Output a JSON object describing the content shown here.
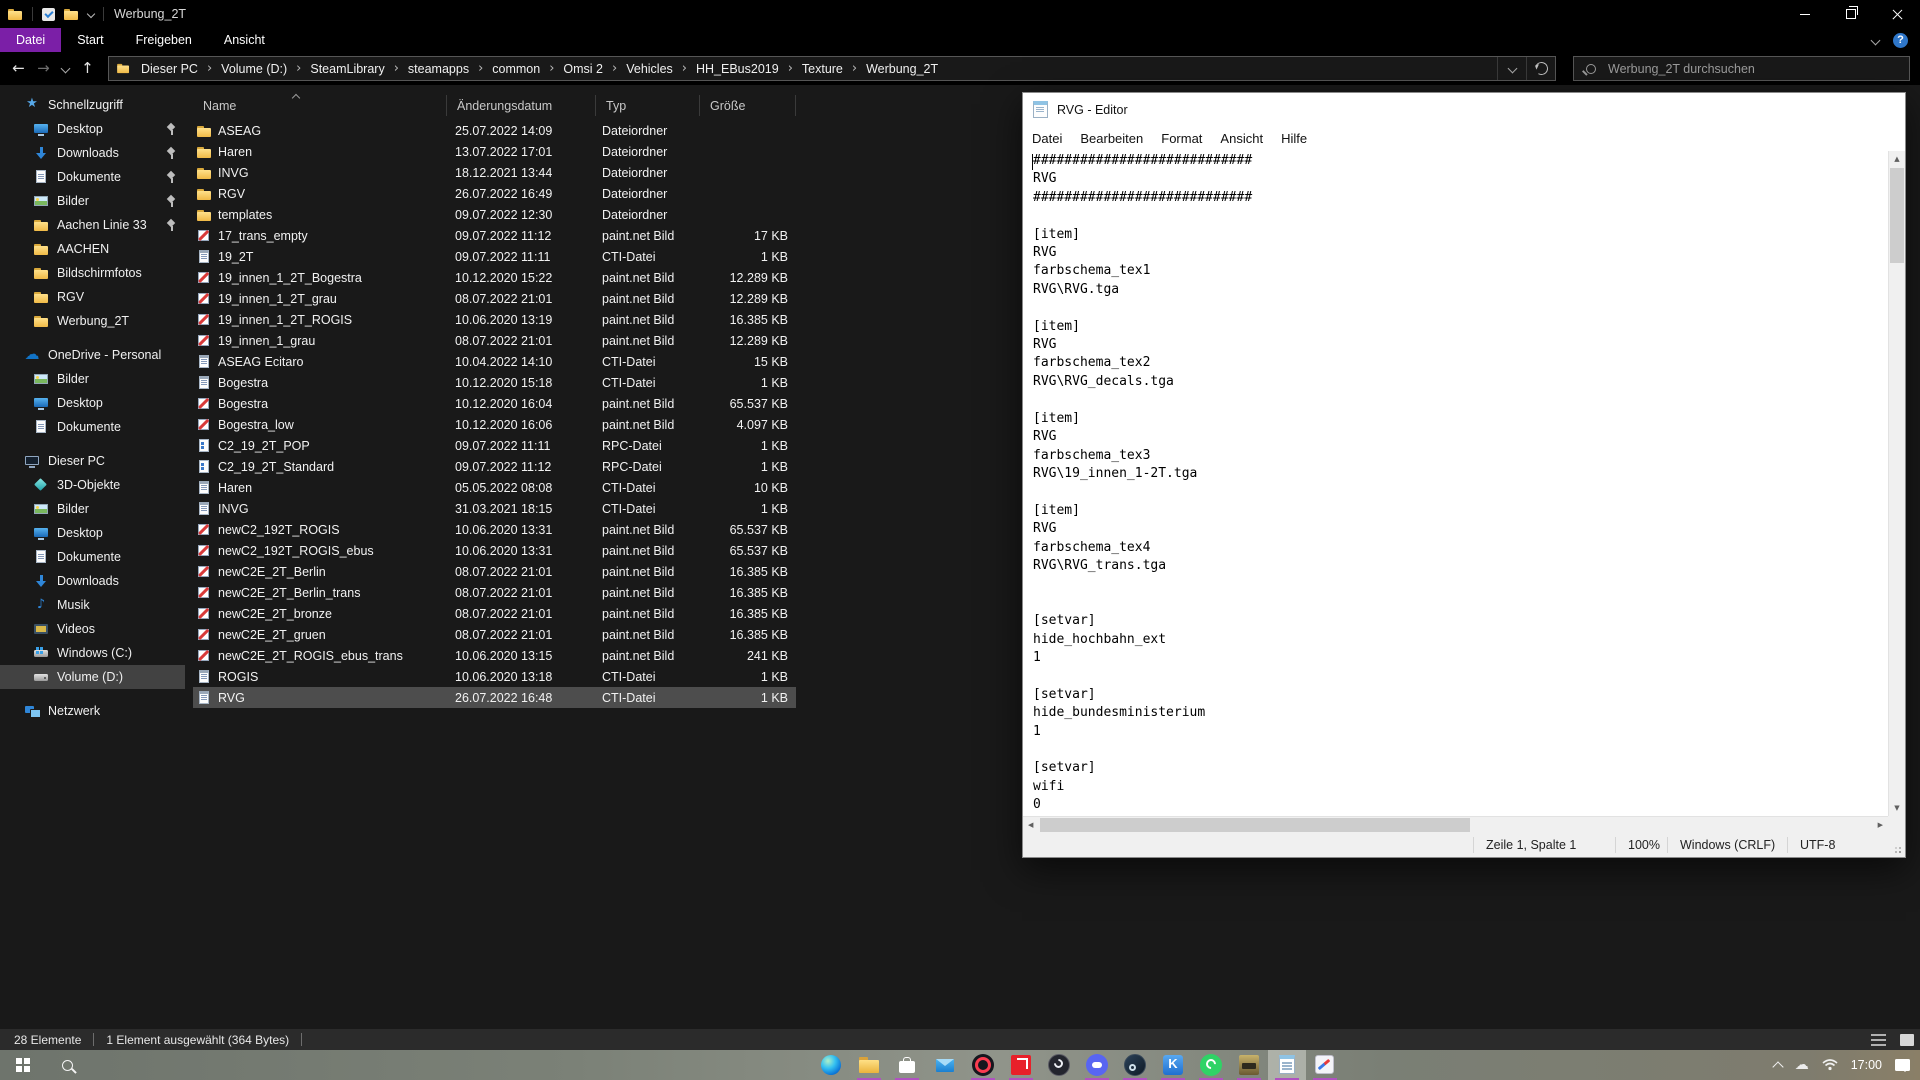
{
  "explorer": {
    "window_title": "Werbung_2T",
    "ribbon_tabs": [
      "Datei",
      "Start",
      "Freigeben",
      "Ansicht"
    ],
    "active_ribbon_tab": "Datei",
    "breadcrumb": [
      "Dieser PC",
      "Volume (D:)",
      "SteamLibrary",
      "steamapps",
      "common",
      "Omsi 2",
      "Vehicles",
      "HH_EBus2019",
      "Texture",
      "Werbung_2T"
    ],
    "search_placeholder": "Werbung_2T durchsuchen",
    "columns": [
      "Name",
      "Änderungsdatum",
      "Typ",
      "Größe"
    ],
    "sidebar": [
      {
        "label": "Schnellzugriff",
        "icon": "star",
        "level": 0
      },
      {
        "label": "Desktop",
        "icon": "desktop",
        "level": 1,
        "pinned": true
      },
      {
        "label": "Downloads",
        "icon": "download",
        "level": 1,
        "pinned": true
      },
      {
        "label": "Dokumente",
        "icon": "document",
        "level": 1,
        "pinned": true
      },
      {
        "label": "Bilder",
        "icon": "pictures",
        "level": 1,
        "pinned": true
      },
      {
        "label": "Aachen Linie 33",
        "icon": "folder",
        "level": 1,
        "pinned": true
      },
      {
        "label": "AACHEN",
        "icon": "folder",
        "level": 1
      },
      {
        "label": "Bildschirmfotos",
        "icon": "folder",
        "level": 1
      },
      {
        "label": "RGV",
        "icon": "folder",
        "level": 1
      },
      {
        "label": "Werbung_2T",
        "icon": "folder",
        "level": 1
      },
      {
        "label": "OneDrive - Personal",
        "icon": "cloud",
        "level": 0,
        "gap": true
      },
      {
        "label": "Bilder",
        "icon": "pictures",
        "level": 1
      },
      {
        "label": "Desktop",
        "icon": "desktop",
        "level": 1
      },
      {
        "label": "Dokumente",
        "icon": "document",
        "level": 1
      },
      {
        "label": "Dieser PC",
        "icon": "pc",
        "level": 0,
        "gap": true
      },
      {
        "label": "3D-Objekte",
        "icon": "cube",
        "level": 1
      },
      {
        "label": "Bilder",
        "icon": "pictures",
        "level": 1
      },
      {
        "label": "Desktop",
        "icon": "desktop",
        "level": 1
      },
      {
        "label": "Dokumente",
        "icon": "document",
        "level": 1
      },
      {
        "label": "Downloads",
        "icon": "download",
        "level": 1
      },
      {
        "label": "Musik",
        "icon": "music",
        "level": 1
      },
      {
        "label": "Videos",
        "icon": "video",
        "level": 1
      },
      {
        "label": "Windows (C:)",
        "icon": "drive-win",
        "level": 1
      },
      {
        "label": "Volume (D:)",
        "icon": "drive",
        "level": 1,
        "selected": true
      },
      {
        "label": "Netzwerk",
        "icon": "network",
        "level": 0,
        "gap": true
      }
    ],
    "files": [
      {
        "name": "ASEAG",
        "date": "25.07.2022 14:09",
        "type": "Dateiordner",
        "size": "",
        "icon": "folder"
      },
      {
        "name": "Haren",
        "date": "13.07.2022 17:01",
        "type": "Dateiordner",
        "size": "",
        "icon": "folder"
      },
      {
        "name": "INVG",
        "date": "18.12.2021 13:44",
        "type": "Dateiordner",
        "size": "",
        "icon": "folder"
      },
      {
        "name": "RGV",
        "date": "26.07.2022 16:49",
        "type": "Dateiordner",
        "size": "",
        "icon": "folder"
      },
      {
        "name": "templates",
        "date": "09.07.2022 12:30",
        "type": "Dateiordner",
        "size": "",
        "icon": "folder"
      },
      {
        "name": "17_trans_empty",
        "date": "09.07.2022 11:12",
        "type": "paint.net Bild",
        "size": "17 KB",
        "icon": "pnet"
      },
      {
        "name": "19_2T",
        "date": "09.07.2022 11:11",
        "type": "CTI-Datei",
        "size": "1 KB",
        "icon": "cti"
      },
      {
        "name": "19_innen_1_2T_Bogestra",
        "date": "10.12.2020 15:22",
        "type": "paint.net Bild",
        "size": "12.289 KB",
        "icon": "pnet"
      },
      {
        "name": "19_innen_1_2T_grau",
        "date": "08.07.2022 21:01",
        "type": "paint.net Bild",
        "size": "12.289 KB",
        "icon": "pnet"
      },
      {
        "name": "19_innen_1_2T_ROGIS",
        "date": "10.06.2020 13:19",
        "type": "paint.net Bild",
        "size": "16.385 KB",
        "icon": "pnet"
      },
      {
        "name": "19_innen_1_grau",
        "date": "08.07.2022 21:01",
        "type": "paint.net Bild",
        "size": "12.289 KB",
        "icon": "pnet"
      },
      {
        "name": "ASEAG Ecitaro",
        "date": "10.04.2022 14:10",
        "type": "CTI-Datei",
        "size": "15 KB",
        "icon": "cti"
      },
      {
        "name": "Bogestra",
        "date": "10.12.2020 15:18",
        "type": "CTI-Datei",
        "size": "1 KB",
        "icon": "cti"
      },
      {
        "name": "Bogestra",
        "date": "10.12.2020 16:04",
        "type": "paint.net Bild",
        "size": "65.537 KB",
        "icon": "pnet"
      },
      {
        "name": "Bogestra_low",
        "date": "10.12.2020 16:06",
        "type": "paint.net Bild",
        "size": "4.097 KB",
        "icon": "pnet"
      },
      {
        "name": "C2_19_2T_POP",
        "date": "09.07.2022 11:11",
        "type": "RPC-Datei",
        "size": "1 KB",
        "icon": "rpc"
      },
      {
        "name": "C2_19_2T_Standard",
        "date": "09.07.2022 11:12",
        "type": "RPC-Datei",
        "size": "1 KB",
        "icon": "rpc"
      },
      {
        "name": "Haren",
        "date": "05.05.2022 08:08",
        "type": "CTI-Datei",
        "size": "10 KB",
        "icon": "cti"
      },
      {
        "name": "INVG",
        "date": "31.03.2021 18:15",
        "type": "CTI-Datei",
        "size": "1 KB",
        "icon": "cti"
      },
      {
        "name": "newC2_192T_ROGIS",
        "date": "10.06.2020 13:31",
        "type": "paint.net Bild",
        "size": "65.537 KB",
        "icon": "pnet"
      },
      {
        "name": "newC2_192T_ROGIS_ebus",
        "date": "10.06.2020 13:31",
        "type": "paint.net Bild",
        "size": "65.537 KB",
        "icon": "pnet"
      },
      {
        "name": "newC2E_2T_Berlin",
        "date": "08.07.2022 21:01",
        "type": "paint.net Bild",
        "size": "16.385 KB",
        "icon": "pnet"
      },
      {
        "name": "newC2E_2T_Berlin_trans",
        "date": "08.07.2022 21:01",
        "type": "paint.net Bild",
        "size": "16.385 KB",
        "icon": "pnet"
      },
      {
        "name": "newC2E_2T_bronze",
        "date": "08.07.2022 21:01",
        "type": "paint.net Bild",
        "size": "16.385 KB",
        "icon": "pnet"
      },
      {
        "name": "newC2E_2T_gruen",
        "date": "08.07.2022 21:01",
        "type": "paint.net Bild",
        "size": "16.385 KB",
        "icon": "pnet"
      },
      {
        "name": "newC2E_2T_ROGIS_ebus_trans",
        "date": "10.06.2020 13:15",
        "type": "paint.net Bild",
        "size": "241 KB",
        "icon": "pnet"
      },
      {
        "name": "ROGIS",
        "date": "10.06.2020 13:18",
        "type": "CTI-Datei",
        "size": "1 KB",
        "icon": "cti"
      },
      {
        "name": "RVG",
        "date": "26.07.2022 16:48",
        "type": "CTI-Datei",
        "size": "1 KB",
        "icon": "cti",
        "selected": true
      }
    ],
    "status": {
      "count": "28 Elemente",
      "selection": "1 Element ausgewählt (364 Bytes)"
    }
  },
  "notepad": {
    "window_title": "RVG - Editor",
    "menu": [
      "Datei",
      "Bearbeiten",
      "Format",
      "Ansicht",
      "Hilfe"
    ],
    "content": "############################\nRVG\n############################\n\n[item]\nRVG\nfarbschema_tex1\nRVG\\RVG.tga\n\n[item]\nRVG\nfarbschema_tex2\nRVG\\RVG_decals.tga\n\n[item]\nRVG\nfarbschema_tex3\nRVG\\19_innen_1-2T.tga\n\n[item]\nRVG\nfarbschema_tex4\nRVG\\RVG_trans.tga\n\n\n[setvar]\nhide_hochbahn_ext\n1\n\n[setvar]\nhide_bundesministerium\n1\n\n[setvar]\nwifi\n0",
    "status": {
      "cursor_position": "Zeile 1, Spalte 1",
      "zoom_level": "100%",
      "line_ending": "Windows (CRLF)",
      "encoding": "UTF-8"
    }
  },
  "taskbar": {
    "clock": "17:00",
    "apps": [
      {
        "name": "edge",
        "running": false
      },
      {
        "name": "explorer",
        "running": true
      },
      {
        "name": "store",
        "running": true
      },
      {
        "name": "mail",
        "running": false
      },
      {
        "name": "opera-gx",
        "running": true
      },
      {
        "name": "amd-radeon",
        "running": true
      },
      {
        "name": "obs",
        "running": false
      },
      {
        "name": "discord",
        "running": true
      },
      {
        "name": "steam",
        "running": true
      },
      {
        "name": "k-app",
        "running": true
      },
      {
        "name": "whatsapp",
        "running": true
      },
      {
        "name": "omsi",
        "running": true
      },
      {
        "name": "notepad",
        "running": true,
        "focused": true
      },
      {
        "name": "paintnet",
        "running": true
      }
    ]
  },
  "colors": {
    "ribbon_accent": "#7b1fa7",
    "taskbar_running_underline": "#b052c0",
    "explorer_background": "#191919",
    "selection_gray": "#4d4d4d"
  }
}
